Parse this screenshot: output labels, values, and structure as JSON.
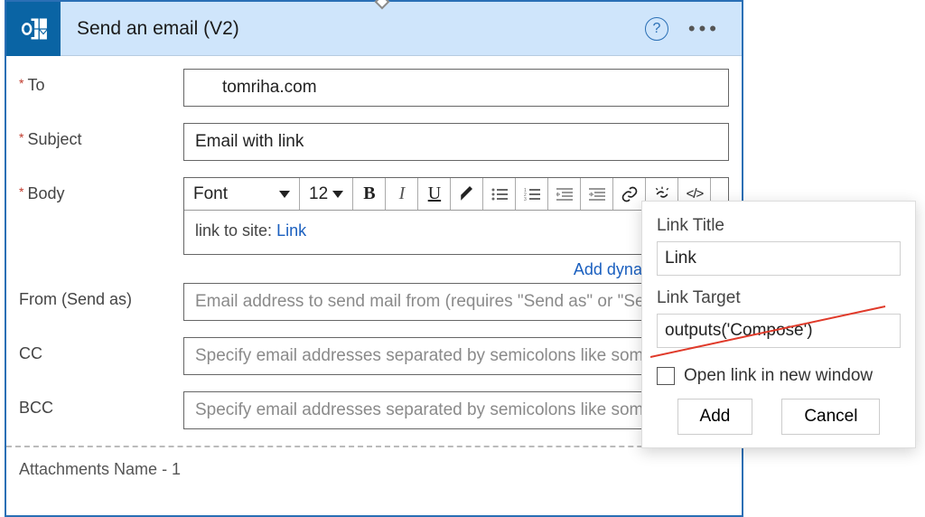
{
  "header": {
    "title": "Send an email (V2)"
  },
  "fields": {
    "to_label": "To",
    "to_value": "tomriha.com",
    "subject_label": "Subject",
    "subject_value": "Email with link",
    "body_label": "Body",
    "body_text_prefix": "link to site:",
    "body_link_text": "Link",
    "from_label": "From (Send as)",
    "from_placeholder": "Email address to send mail from (requires \"Send as\" or \"Send on behalf of\" permission)",
    "cc_label": "CC",
    "cc_placeholder": "Specify email addresses separated by semicolons like someone@contoso.com",
    "bcc_label": "BCC",
    "bcc_placeholder": "Specify email addresses separated by semicolons like someone@contoso.com",
    "add_dynamic": "Add dynamic content"
  },
  "toolbar": {
    "font_label": "Font",
    "size_label": "12"
  },
  "attachments": {
    "label": "Attachments Name - 1"
  },
  "popup": {
    "title_label": "Link Title",
    "title_value": "Link",
    "target_label": "Link Target",
    "target_value": "outputs('Compose')",
    "new_window": "Open link in new window",
    "add": "Add",
    "cancel": "Cancel"
  }
}
